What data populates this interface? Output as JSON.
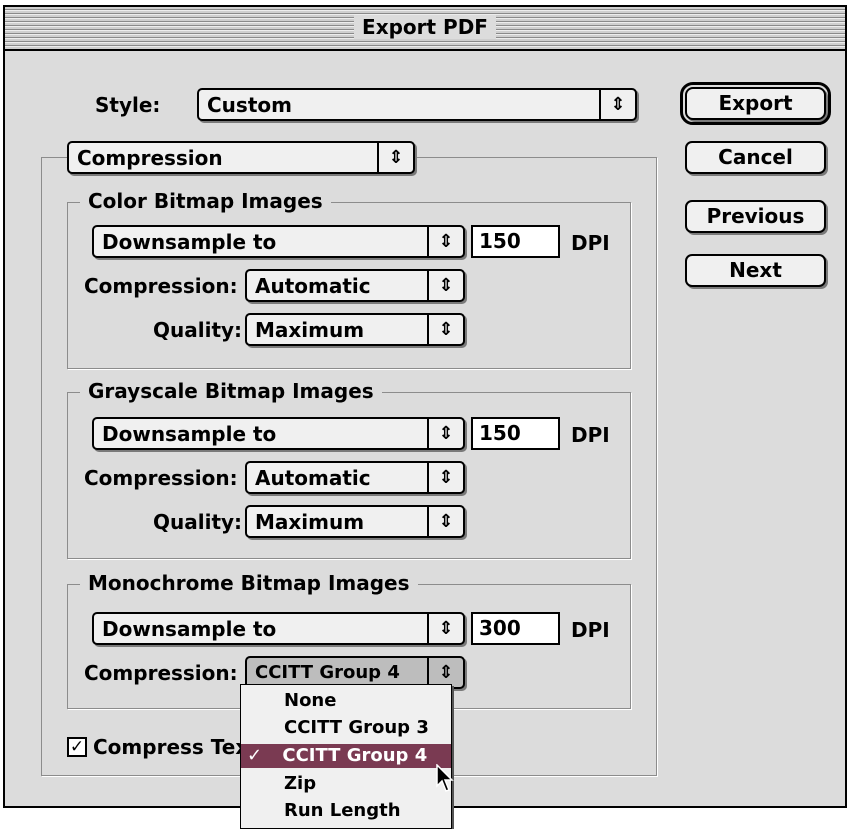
{
  "window": {
    "title": "Export PDF"
  },
  "style": {
    "label": "Style:",
    "value": "Custom"
  },
  "section_popup": {
    "value": "Compression"
  },
  "buttons": {
    "export": "Export",
    "cancel": "Cancel",
    "previous": "Previous",
    "next": "Next"
  },
  "color_group": {
    "title": "Color Bitmap Images",
    "downsample": "Downsample to",
    "dpi_value": "150",
    "dpi_unit": "DPI",
    "compression_label": "Compression:",
    "compression_value": "Automatic",
    "quality_label": "Quality:",
    "quality_value": "Maximum"
  },
  "grayscale_group": {
    "title": "Grayscale Bitmap Images",
    "downsample": "Downsample to",
    "dpi_value": "150",
    "dpi_unit": "DPI",
    "compression_label": "Compression:",
    "compression_value": "Automatic",
    "quality_label": "Quality:",
    "quality_value": "Maximum"
  },
  "mono_group": {
    "title": "Monochrome Bitmap Images",
    "downsample": "Downsample to",
    "dpi_value": "300",
    "dpi_unit": "DPI",
    "compression_label": "Compression:",
    "compression_value": "CCITT Group 4"
  },
  "compression_menu": {
    "items": [
      "None",
      "CCITT Group 3",
      "CCITT Group 4",
      "Zip",
      "Run Length"
    ],
    "selected": "CCITT Group 4",
    "check": "✓"
  },
  "compress_text": {
    "label": "Compress Tex",
    "checked": true,
    "mark": "✓"
  },
  "icons": {
    "popup_arrows": "updown-arrows-icon",
    "cursor": "arrow-cursor-icon"
  }
}
